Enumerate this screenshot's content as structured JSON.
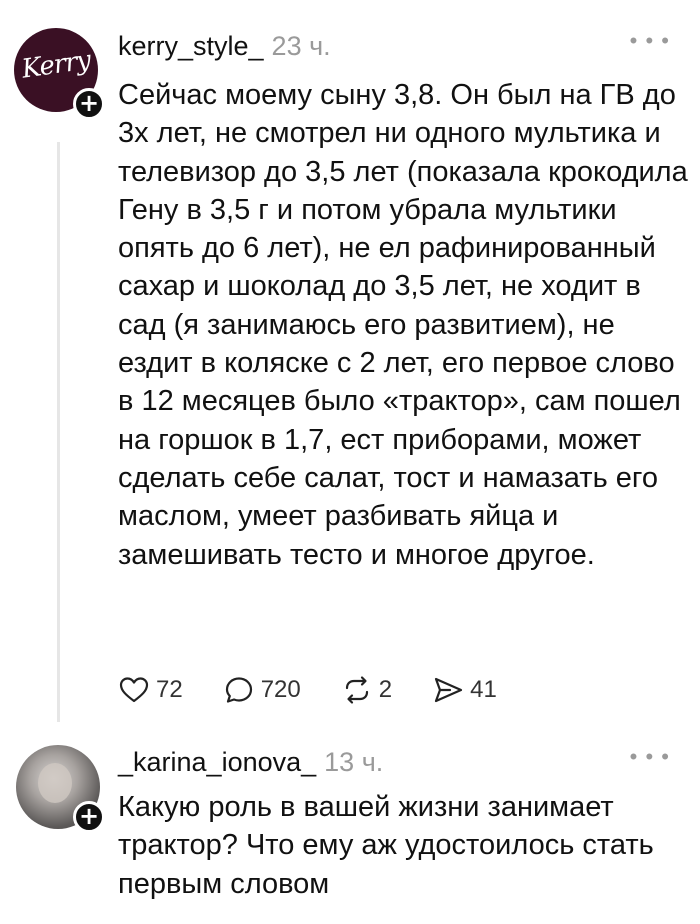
{
  "posts": [
    {
      "username": "kerry_style_",
      "time": "23 ч.",
      "avatar_logo": "Kerry",
      "text": "Сейчас моему сыну 3,8. Он был на ГВ до 3х лет, не смотрел ни одного мультика и телевизор до 3,5 лет (показала крокодила Гену в 3,5 г и потом убрала мультики опять до 6 лет), не ел рафинированный сахар и шоколад до 3,5 лет, не ходит в сад (я занимаюсь его развитием), не ездит в коляске с 2 лет, его первое слово в 12 месяцев было «трактор», сам пошел на горшок в 1,7, ест приборами, может сделать себе салат, тост и намазать его маслом, умеет разбивать яйца и замешивать тесто и многое другое.",
      "actions": {
        "likes": "72",
        "comments": "720",
        "reposts": "2",
        "shares": "41"
      }
    },
    {
      "username": "_karina_ionova_",
      "time": "13 ч.",
      "text": "Какую роль в вашей жизни занимает трактор? Что ему аж удостоилось стать первым словом"
    }
  ],
  "icons": {
    "more": "more-icon",
    "follow": "plus-icon",
    "like": "heart-icon",
    "comment": "comment-icon",
    "repost": "repost-icon",
    "share": "share-icon"
  },
  "colors": {
    "text": "#111111",
    "muted": "#9a9a9a",
    "thread_line": "#e6e6e6"
  }
}
